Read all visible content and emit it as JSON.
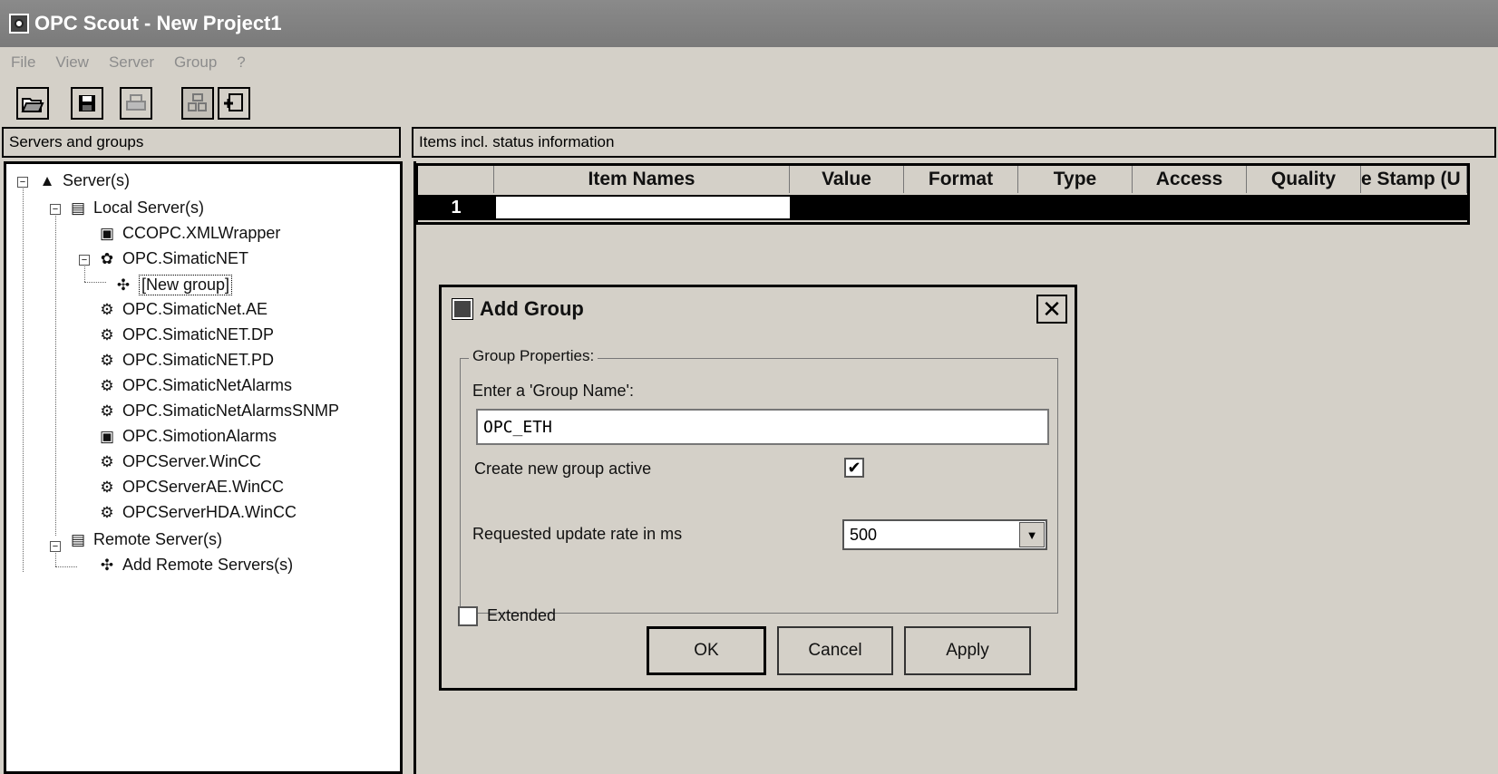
{
  "window": {
    "title": "OPC Scout - New Project1"
  },
  "menu": [
    "File",
    "View",
    "Server",
    "Group",
    "?"
  ],
  "toolbar": {
    "icons": [
      "open-folder-icon",
      "save-icon",
      "print-icon",
      "browse-icon",
      "add-item-icon"
    ]
  },
  "left_pane": {
    "header": "Servers and groups",
    "tree": [
      {
        "label": "Server(s)",
        "icon": "network-icon"
      },
      {
        "label": "Local Server(s)",
        "icon": "computer-icon"
      },
      {
        "label": "CCOPC.XMLWrapper",
        "icon": "opc-server-icon"
      },
      {
        "label": "OPC.SimaticNET",
        "icon": "simatic-icon"
      },
      {
        "label": "[New group]",
        "icon": "wand-icon"
      },
      {
        "label": "OPC.SimaticNet.AE",
        "icon": "gear-server-icon"
      },
      {
        "label": "OPC.SimaticNET.DP",
        "icon": "gear-server-icon"
      },
      {
        "label": "OPC.SimaticNET.PD",
        "icon": "gear-server-icon"
      },
      {
        "label": "OPC.SimaticNetAlarms",
        "icon": "gear-server-icon"
      },
      {
        "label": "OPC.SimaticNetAlarmsSNMP",
        "icon": "gear-server-icon"
      },
      {
        "label": "OPC.SimotionAlarms",
        "icon": "opc-server-icon"
      },
      {
        "label": "OPCServer.WinCC",
        "icon": "gear-server-icon"
      },
      {
        "label": "OPCServerAE.WinCC",
        "icon": "gear-server-icon"
      },
      {
        "label": "OPCServerHDA.WinCC",
        "icon": "gear-server-icon"
      },
      {
        "label": "Remote Server(s)",
        "icon": "computer-icon"
      },
      {
        "label": "Add Remote Servers(s)",
        "icon": "wand-icon"
      }
    ]
  },
  "right_pane": {
    "header": "Items incl. status information",
    "columns": [
      "Item Names",
      "Value",
      "Format",
      "Type",
      "Access",
      "Quality",
      "e Stamp (U"
    ],
    "rows": [
      {
        "num": "1"
      }
    ]
  },
  "dialog": {
    "title": "Add Group",
    "group_properties_label": "Group Properties:",
    "name_label": "Enter a 'Group Name':",
    "name_value": "OPC_ETH",
    "active_label": "Create new group active",
    "active_checked": true,
    "rate_label": "Requested update rate in ms",
    "rate_value": "500",
    "extended_label": "Extended",
    "extended_checked": false,
    "ok_label": "OK",
    "cancel_label": "Cancel",
    "apply_label": "Apply"
  }
}
